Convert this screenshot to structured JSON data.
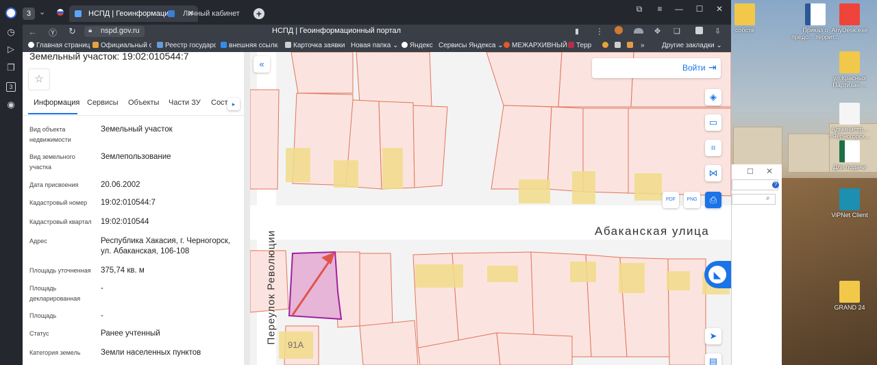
{
  "browser": {
    "tab_badge": "3",
    "tabs": [
      {
        "label": "НСПД | Геоинформаци",
        "active": true
      },
      {
        "label": "Личный кабинет",
        "active": false
      }
    ],
    "address": "nspd.gov.ru",
    "page_title": "НСПД | Геоинформационный портал",
    "sidebar_badge": "3",
    "bookmarks": [
      "Главная страниц",
      "Официальный са",
      "Реестр государст",
      "внешняя ссылка",
      "Карточка заявки",
      "Новая папка",
      "Яндекс",
      "Сервисы Яндекса",
      "МЕЖАРХИВНЫЙ",
      "Терр",
      "Другие закладки"
    ],
    "bookmark_colors": [
      "#ffffff",
      "#e8a23a",
      "#6a9bd8",
      "#2f8fe8",
      "#cfcfcf",
      "#ffffff",
      "#ffffff",
      "#ffffff",
      "#e05a2b",
      "#b0304a",
      "#ffffff"
    ]
  },
  "panel": {
    "title": "Земельный участок: 19:02:010544:7",
    "tabs": [
      "Информация",
      "Сервисы",
      "Объекты",
      "Части ЗУ",
      "Соста"
    ],
    "fields": [
      {
        "label": "Вид объекта недвижимости",
        "value": "Земельный участок"
      },
      {
        "label": "Вид земельного участка",
        "value": "Землепользование"
      },
      {
        "label": "Дата присвоения",
        "value": "20.06.2002"
      },
      {
        "label": "Кадастровый номер",
        "value": "19:02:010544:7"
      },
      {
        "label": "Кадастровый квартал",
        "value": "19:02:010544"
      },
      {
        "label": "Адрес",
        "value": "Республика Хакасия, г. Черногорск, ул. Абаканская, 106-108"
      },
      {
        "label": "Площадь уточненная",
        "value": "375,74 кв. м"
      },
      {
        "label": "Площадь декларированная",
        "value": "-"
      },
      {
        "label": "Площадь",
        "value": "-"
      },
      {
        "label": "Статус",
        "value": "Ранее учтенный"
      },
      {
        "label": "Категория земель",
        "value": "Земли населенных пунктов"
      }
    ]
  },
  "map": {
    "login_label": "Войти",
    "street_main": "Абаканская улица",
    "street_side": "Переулок Революции",
    "parcel_label": "91А",
    "pdf_label": "PDF",
    "png_label": "PNG"
  },
  "desktop": {
    "icons": [
      "собств",
      "Приказ о предо... террит...",
      "AnyDesk.exe",
      "ул.Красных Партизан ...",
      "Администр... г.Черногорск...",
      "Для подачи",
      "ViPNet Client",
      "GRAND 24"
    ]
  },
  "colors": {
    "accent": "#1a73e8",
    "parcel_fill": "#fbe4df",
    "parcel_stroke": "#e2735b",
    "building_fill": "#f1dc8a",
    "selected_stroke": "#a020a0",
    "selected_fill": "#e6b5d8"
  }
}
